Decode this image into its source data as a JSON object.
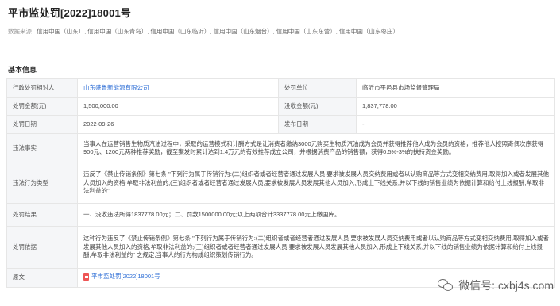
{
  "page": {
    "title": "平市监处罚[2022]18001号"
  },
  "source": {
    "label": "数据来源",
    "links": "信用中国（山东）, 信用中国（山东青岛）, 信用中国（山东临沂）, 信用中国（山东烟台）, 信用中国（山东东营）, 信用中国（山东枣庄）"
  },
  "section": {
    "title": "基本信息"
  },
  "table": {
    "row1": {
      "label_a": "行政处罚相对人",
      "value_a": "山东盛鲁新能源有限公司",
      "label_b": "处罚单位",
      "value_b": "临沂市平邑县市场监督管理局"
    },
    "row2": {
      "label_a": "处罚金额(元)",
      "value_a": "1,500,000.00",
      "label_b": "没收金额(元)",
      "value_b": "1,837,778.00"
    },
    "row3": {
      "label_a": "处罚日期",
      "value_a": "2022-09-26",
      "label_b": "发布日期",
      "value_b": "-"
    },
    "row4": {
      "label": "违法事实",
      "value": "当事人在运营销售生物质汽油过程中，采取的运营模式和计酬方式是让消费者缴纳3000元购买生物质汽油成为会员并获得推荐他人成为会员的资格，推荐他人按照奇偶次序获得900元、1200元两种推荐奖励，截至案发时累计达到1.4万元的有效推荐成立公司，并根据消费产品的销售额，获得0.5%-3%的扶持资金奖励。"
    },
    "row5": {
      "label": "违法行为类型",
      "value": "违反了《禁止传销条例》第七条 \"下列行为属于传销行为:(二)组织者或者经营者通过发展人员,要求被发展人员交纳费用或者以认购商品等方式变相交纳费用,取得加入或者发展其他人员加入的资格,牟取非法利益的;(三)组织者或者经营者通过发展人员,要求被发展人员发展其他人员加入,形成上下线关系,并以下线的销售业绩为依据计算和给付上线报酬,牟取非法利益的\""
    },
    "row6": {
      "label": "处罚结果",
      "value": "一、没收违法所得1837778.00元；二、罚款1500000.00元;以上两项合计3337778.00元上缴国库。"
    },
    "row7": {
      "label": "处罚依据",
      "value": "这种行为违反了《禁止传销条例》第七条 \"下列行为属于传销行为:(二)组织者或者经营者通过发展人员,要求被发展人员交纳费用或者以认购商品等方式变相交纳费用,取得加入或者发展其他人员加入的资格,牟取非法利益的;(三)组织者或者经营者通过发展人员,要求被发展人员发展其他人员加入,形成上下线关系,并以下线的销售业绩为依据计算和给付上线报酬,牟取非法利益的\" 之规定,当事人的行为构成组织策划传销行为。"
    },
    "row8": {
      "label": "原文",
      "value": "平市监处罚[2022]18001号"
    }
  },
  "watermark": {
    "text": "微信号: cxbj4s.com"
  },
  "colors": {
    "link": "#2f6fd6",
    "label_bg": "#f5f6f8",
    "border": "#e6e6e6"
  }
}
